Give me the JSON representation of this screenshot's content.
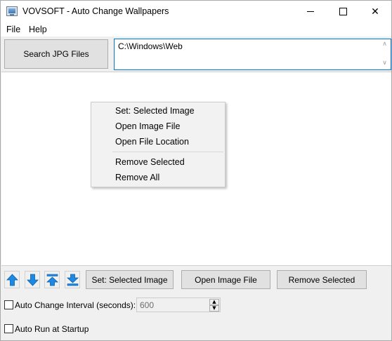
{
  "window": {
    "title": "VOVSOFT - Auto Change Wallpapers"
  },
  "menu": {
    "file": "File",
    "help": "Help"
  },
  "toolbar": {
    "search_label": "Search JPG Files"
  },
  "path": {
    "value": "C:\\Windows\\Web"
  },
  "context_menu": {
    "items": [
      "Set: Selected Image",
      "Open Image File",
      "Open File Location",
      "Remove Selected",
      "Remove All"
    ]
  },
  "actions": {
    "set_label": "Set: Selected Image",
    "open_label": "Open Image File",
    "remove_label": "Remove Selected"
  },
  "options": {
    "interval_label": "Auto Change Interval (seconds):",
    "interval_value": "600",
    "startup_label": "Auto Run at Startup"
  },
  "colors": {
    "accent": "#0078d7",
    "arrow_blue": "#1e88e5"
  }
}
